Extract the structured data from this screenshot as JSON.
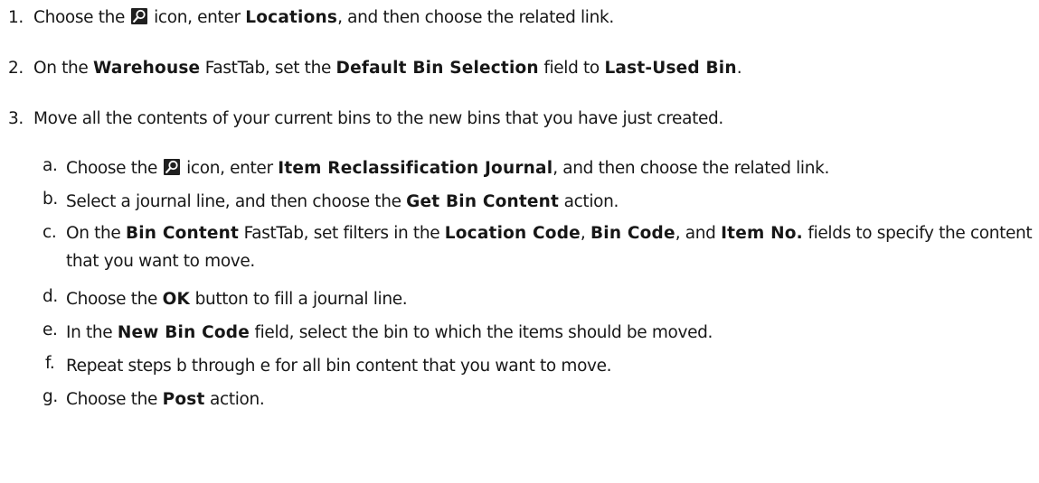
{
  "steps": [
    {
      "num": "1.",
      "t1": "Choose the ",
      "t2": " icon, enter ",
      "b1": "Locations",
      "t3": ", and then choose the related link."
    },
    {
      "num": "2.",
      "t1": "On the ",
      "b1": "Warehouse",
      "t2": " FastTab, set the ",
      "b2": "Default Bin Selection",
      "t3": " field to ",
      "b3": "Last-Used Bin",
      "t4": "."
    },
    {
      "num": "3.",
      "t1": "Move all the contents of your current bins to the new bins that you have just created."
    }
  ],
  "substeps": {
    "a": {
      "letter": "a.",
      "t1": "Choose the ",
      "t2": " icon, enter ",
      "b1": "Item Reclassification Journal",
      "t3": ", and then choose the related link."
    },
    "b": {
      "letter": "b.",
      "t1": "Select a journal line, and then choose the ",
      "b1": "Get Bin Content",
      "t2": " action."
    },
    "c": {
      "letter": "c.",
      "t1": "On the ",
      "b1": "Bin Content",
      "t2": " FastTab, set filters in the ",
      "b2": "Location Code",
      "t3": ", ",
      "b3": "Bin Code",
      "t4": ", and ",
      "b4": "Item No.",
      "t5": " fields to specify the content that you want to move."
    },
    "d": {
      "letter": "d.",
      "t1": "Choose the ",
      "b1": "OK",
      "t2": " button to fill a journal line."
    },
    "e": {
      "letter": "e.",
      "t1": "In the ",
      "b1": "New Bin Code",
      "t2": " field, select the bin to which the items should be moved."
    },
    "f": {
      "letter": "f.",
      "t1": "Repeat steps b through e for all bin content that you want to move."
    },
    "g": {
      "letter": "g.",
      "t1": "Choose the ",
      "b1": "Post",
      "t2": " action."
    }
  }
}
